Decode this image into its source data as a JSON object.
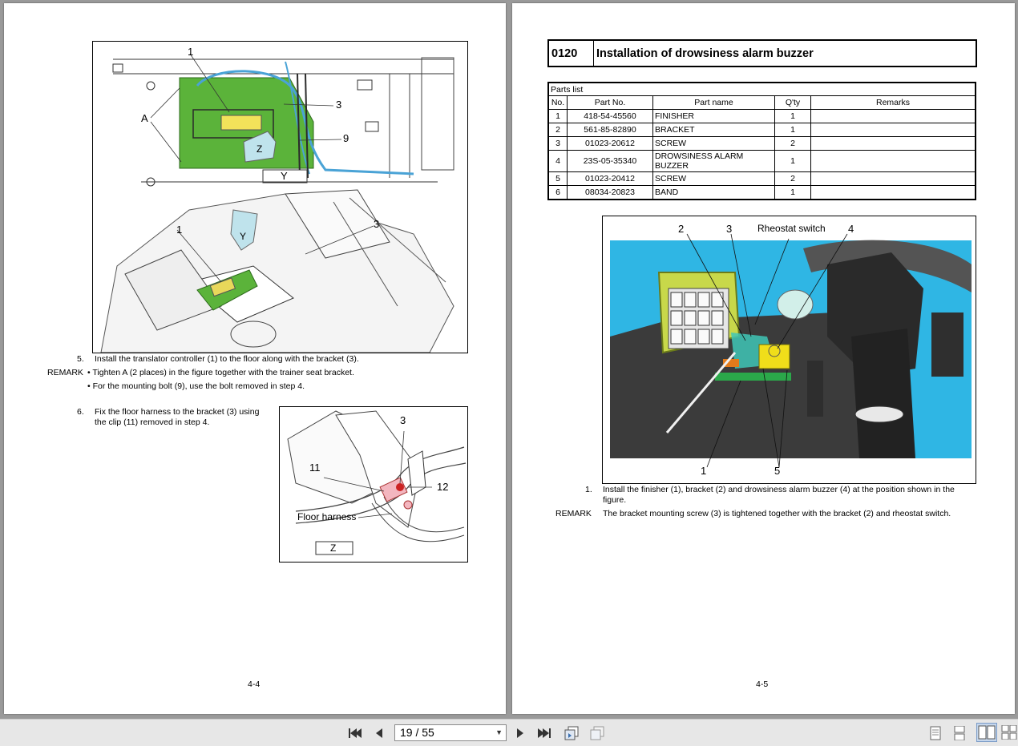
{
  "left_page": {
    "figure_top_labels": {
      "callout_1": "1",
      "callout_3": "3",
      "callout_9": "9",
      "callout_a": "A",
      "label_z": "Z",
      "label_y": "Y"
    },
    "figure_mid_labels": {
      "callout_1": "1",
      "callout_3": "3",
      "label_y": "Y"
    },
    "step5_num": "5.",
    "step5_text": "Install the translator controller (1) to the floor along with the bracket (3).",
    "remark_label": "REMARK",
    "remark_bullet1": "• Tighten A (2 places) in the figure together with the trainer seat bracket.",
    "remark_bullet2": "• For the mounting bolt (9), use the bolt removed in step 4.",
    "step6_num": "6.",
    "step6_text": "Fix the floor harness to the bracket (3) using the clip (11) removed in step 4.",
    "figure_small_labels": {
      "callout_3": "3",
      "callout_11": "11",
      "callout_12": "12",
      "floor_harness": "Floor harness",
      "label_z": "Z"
    },
    "page_number": "4-4"
  },
  "right_page": {
    "section_code": "0120",
    "section_title": "Installation of drowsiness alarm buzzer",
    "parts_caption": "Parts list",
    "parts_headers": [
      "No.",
      "Part No.",
      "Part name",
      "Q'ty",
      "Remarks"
    ],
    "parts_rows": [
      [
        "1",
        "418-54-45560",
        "FINISHER",
        "1",
        ""
      ],
      [
        "2",
        "561-85-82890",
        "BRACKET",
        "1",
        ""
      ],
      [
        "3",
        "01023-20612",
        "SCREW",
        "2",
        ""
      ],
      [
        "4",
        "23S-05-35340",
        "DROWSINESS ALARM BUZZER",
        "1",
        ""
      ],
      [
        "5",
        "01023-20412",
        "SCREW",
        "2",
        ""
      ],
      [
        "6",
        "08034-20823",
        "BAND",
        "1",
        ""
      ]
    ],
    "photo_labels": {
      "callout_2": "2",
      "callout_3": "3",
      "rheostat": "Rheostat switch",
      "callout_4": "4",
      "callout_1": "1",
      "callout_5": "5"
    },
    "step1_num": "1.",
    "step1_text": "Install the finisher (1), bracket (2) and drowsiness alarm buzzer (4) at the position shown in the figure.",
    "remark_label": "REMARK",
    "remark_text": "The bracket mounting screw (3) is tightened together with the bracket (2) and rheostat switch.",
    "page_number": "4-5"
  },
  "toolbar": {
    "page_field": "19 / 55",
    "icons": [
      "first-page-icon",
      "previous-page-icon",
      "next-page-icon",
      "last-page-icon",
      "extract-pages-icon",
      "print-pages-icon",
      "single-page-view-icon",
      "continuous-view-icon",
      "two-page-view-icon",
      "two-page-continuous-view-icon"
    ]
  }
}
